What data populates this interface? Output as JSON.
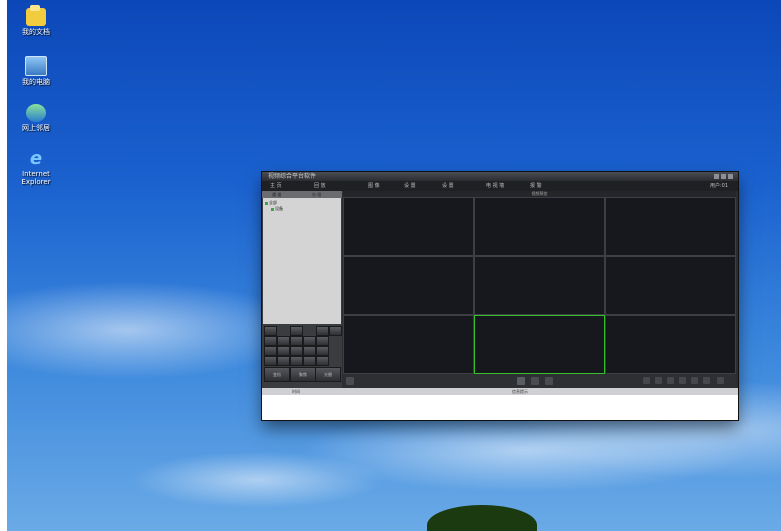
{
  "desktop": {
    "icons": [
      {
        "label": "我的文档",
        "icon": "folder-documents-icon"
      },
      {
        "label": "我的电脑",
        "icon": "computer-icon"
      },
      {
        "label": "网上邻居",
        "icon": "network-icon"
      },
      {
        "label": "Internet Explorer",
        "icon": "ie-icon"
      }
    ]
  },
  "app": {
    "title": "视频综合平台软件",
    "menu": [
      "主 页",
      "回 放",
      "图 像",
      "设 置",
      "设 置",
      "电 视 墙",
      "报 警"
    ],
    "right_status": "用户:01",
    "left_tabs": [
      "通 道",
      "分 组"
    ],
    "tree_nodes": [
      "全部",
      "设备"
    ],
    "grid_header": "视频预览",
    "ptz_big_labels": [
      "变倍",
      "聚焦",
      "光圈"
    ],
    "log_columns": [
      "时间",
      "信息提示"
    ]
  },
  "colors": {
    "selected_border": "#34c02b",
    "grid_bg": "#16181d"
  }
}
